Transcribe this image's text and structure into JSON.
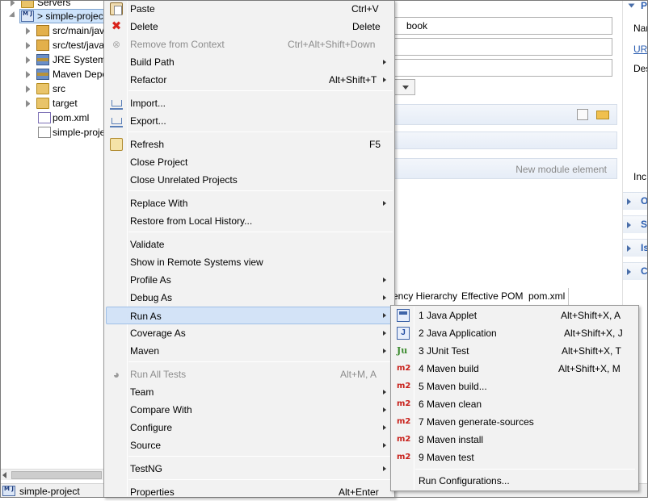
{
  "explorer": {
    "items": [
      {
        "label": "Servers",
        "icon": "folder-icon"
      },
      {
        "label": "> simple-project",
        "icon": "maven-project-icon"
      },
      {
        "label": "src/main/java",
        "icon": "source-folder-icon"
      },
      {
        "label": "src/test/java",
        "icon": "source-folder-icon"
      },
      {
        "label": "JRE System Library",
        "icon": "library-icon"
      },
      {
        "label": "Maven Dependencies",
        "icon": "library-icon"
      },
      {
        "label": "src",
        "icon": "folder-icon"
      },
      {
        "label": "target",
        "icon": "folder-icon"
      },
      {
        "label": "pom.xml",
        "icon": "xml-file-icon"
      },
      {
        "label": "simple-project",
        "icon": "file-icon"
      }
    ]
  },
  "status": {
    "label": "simple-project"
  },
  "editor": {
    "field1_value": "book",
    "module_placeholder": "New module element",
    "tabs": [
      "ency Hierarchy",
      "Effective POM",
      "pom.xml"
    ],
    "right_labels": [
      "P",
      "Nar",
      "URI",
      "Des",
      "Inc",
      "O",
      "S",
      "Is",
      "C"
    ]
  },
  "context_menu": {
    "items": [
      {
        "label": "Paste",
        "accel": "Ctrl+V",
        "icon": "paste-icon"
      },
      {
        "label": "Delete",
        "accel": "Delete",
        "icon": "delete-icon"
      },
      {
        "label": "Remove from Context",
        "accel": "Ctrl+Alt+Shift+Down",
        "icon": "remove-context-icon",
        "disabled": true
      },
      {
        "label": "Build Path",
        "submenu": true
      },
      {
        "label": "Refactor",
        "accel": "Alt+Shift+T",
        "submenu": true
      },
      {
        "label": "Import...",
        "icon": "import-icon"
      },
      {
        "label": "Export...",
        "icon": "export-icon"
      },
      {
        "label": "Refresh",
        "accel": "F5",
        "icon": "refresh-icon"
      },
      {
        "label": "Close Project"
      },
      {
        "label": "Close Unrelated Projects"
      },
      {
        "label": "Replace With",
        "submenu": true
      },
      {
        "label": "Restore from Local History..."
      },
      {
        "label": "Validate"
      },
      {
        "label": "Show in Remote Systems view"
      },
      {
        "label": "Profile As",
        "submenu": true
      },
      {
        "label": "Debug As",
        "submenu": true
      },
      {
        "label": "Run As",
        "submenu": true,
        "highlighted": true
      },
      {
        "label": "Coverage As",
        "submenu": true
      },
      {
        "label": "Maven",
        "submenu": true
      },
      {
        "label": "Run All Tests",
        "accel": "Alt+M, A",
        "icon": "run-all-tests-icon",
        "disabled": true
      },
      {
        "label": "Team",
        "submenu": true
      },
      {
        "label": "Compare With",
        "submenu": true
      },
      {
        "label": "Configure",
        "submenu": true
      },
      {
        "label": "Source",
        "submenu": true
      },
      {
        "label": "TestNG",
        "submenu": true
      },
      {
        "label": "Properties",
        "accel": "Alt+Enter"
      }
    ]
  },
  "run_as_menu": {
    "items": [
      {
        "label": "1 Java Applet",
        "accel": "Alt+Shift+X, A",
        "icon": "java-applet-icon"
      },
      {
        "label": "2 Java Application",
        "accel": "Alt+Shift+X, J",
        "icon": "java-application-icon"
      },
      {
        "label": "3 JUnit Test",
        "accel": "Alt+Shift+X, T",
        "icon": "junit-icon",
        "icon_text": "Ju"
      },
      {
        "label": "4 Maven build",
        "accel": "Alt+Shift+X, M",
        "icon": "maven-m2-icon",
        "icon_text": "m2"
      },
      {
        "label": "5 Maven build...",
        "icon": "maven-m2-icon",
        "icon_text": "m2"
      },
      {
        "label": "6 Maven clean",
        "icon": "maven-m2-icon",
        "icon_text": "m2"
      },
      {
        "label": "7 Maven generate-sources",
        "icon": "maven-m2-icon",
        "icon_text": "m2"
      },
      {
        "label": "8 Maven install",
        "icon": "maven-m2-icon",
        "icon_text": "m2"
      },
      {
        "label": "9 Maven test",
        "icon": "maven-m2-icon",
        "icon_text": "m2"
      },
      {
        "label": "Run Configurations..."
      }
    ]
  }
}
